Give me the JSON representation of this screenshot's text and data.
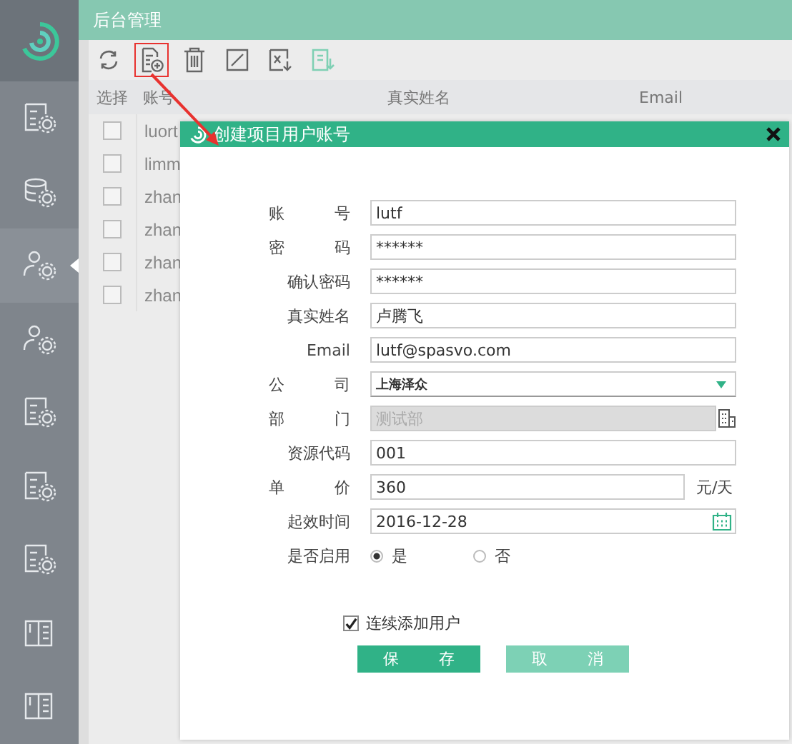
{
  "app": {
    "title": "后台管理"
  },
  "sidebar": {
    "items": [
      {
        "selected": false
      },
      {
        "selected": false
      },
      {
        "selected": true
      },
      {
        "selected": false
      },
      {
        "selected": false
      },
      {
        "selected": false
      },
      {
        "selected": false
      },
      {
        "selected": false
      },
      {
        "selected": false
      }
    ]
  },
  "toolbar": [
    {
      "kind": "refresh",
      "highlighted": false
    },
    {
      "kind": "add",
      "highlighted": true
    },
    {
      "kind": "delete",
      "highlighted": false
    },
    {
      "kind": "edit",
      "highlighted": false
    },
    {
      "kind": "export",
      "highlighted": false
    },
    {
      "kind": "import",
      "highlighted": false
    }
  ],
  "table": {
    "columns": [
      "选择",
      "账号",
      "真实姓名",
      "Email"
    ],
    "rows": [
      {
        "account": "luort",
        "checked": false
      },
      {
        "account": "limm",
        "checked": false
      },
      {
        "account": "zhan",
        "checked": false
      },
      {
        "account": "zhan",
        "checked": false
      },
      {
        "account": "zhan",
        "checked": false
      },
      {
        "account": "zhan",
        "checked": false
      }
    ]
  },
  "dialog": {
    "title": "创建项目用户账号",
    "fields": [
      {
        "kind": "text",
        "label": "账 号",
        "value": "lutf"
      },
      {
        "kind": "text",
        "label": "密 码",
        "value": "******"
      },
      {
        "kind": "text",
        "label": "确认密码",
        "value": "******"
      },
      {
        "kind": "text",
        "label": "真实姓名",
        "value": "卢腾飞"
      },
      {
        "kind": "text",
        "label": "Email",
        "value": "lutf@spasvo.com"
      },
      {
        "kind": "select",
        "label": "公 司",
        "value": "上海泽众"
      },
      {
        "kind": "picker",
        "label": "部 门",
        "value": "测试部",
        "disabled": true
      },
      {
        "kind": "text",
        "label": "资源代码",
        "value": "001"
      },
      {
        "kind": "unit",
        "label": "单 价",
        "value": "360",
        "unit": "元/天"
      },
      {
        "kind": "date",
        "label": "起效时间",
        "value": "2016-12-28"
      },
      {
        "kind": "radio",
        "label": "是否启用",
        "options": [
          {
            "label": "是",
            "selected": true
          },
          {
            "label": "否",
            "selected": false
          }
        ]
      }
    ],
    "continuous": {
      "label": "连续添加用户",
      "checked": true
    },
    "buttons": [
      {
        "label": "保 存",
        "primary": true
      },
      {
        "label": "取 消",
        "primary": false
      }
    ]
  }
}
